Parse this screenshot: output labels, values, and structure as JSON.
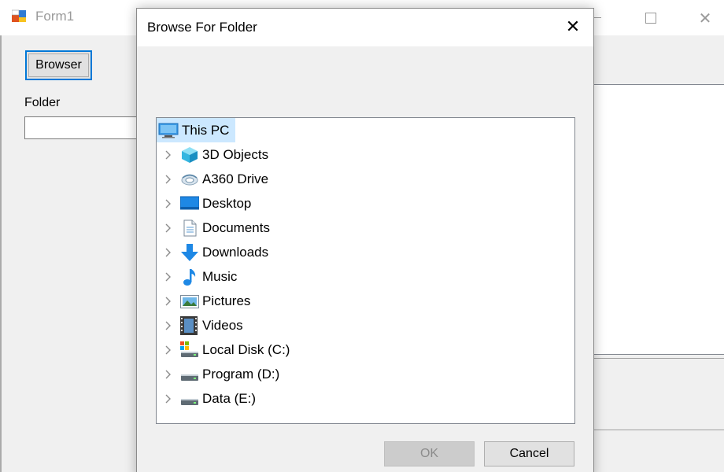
{
  "form1": {
    "title": "Form1",
    "browser_button": "Browser",
    "folder_label": "Folder",
    "folder_value": ""
  },
  "dialog": {
    "title": "Browse For Folder",
    "ok_label": "OK",
    "cancel_label": "Cancel",
    "tree": {
      "root": {
        "label": "This PC",
        "icon": "this-pc-icon"
      },
      "items": [
        {
          "label": "3D Objects",
          "icon": "3d-objects-icon"
        },
        {
          "label": "A360 Drive",
          "icon": "a360-drive-icon"
        },
        {
          "label": "Desktop",
          "icon": "desktop-icon"
        },
        {
          "label": "Documents",
          "icon": "documents-icon"
        },
        {
          "label": "Downloads",
          "icon": "downloads-icon"
        },
        {
          "label": "Music",
          "icon": "music-icon"
        },
        {
          "label": "Pictures",
          "icon": "pictures-icon"
        },
        {
          "label": "Videos",
          "icon": "videos-icon"
        },
        {
          "label": "Local Disk (C:)",
          "icon": "local-disk-icon"
        },
        {
          "label": "Program (D:)",
          "icon": "drive-icon"
        },
        {
          "label": "Data (E:)",
          "icon": "drive-icon"
        }
      ]
    }
  },
  "colors": {
    "selection": "#cce8ff",
    "focus_border": "#0078d7",
    "window_bg": "#f0f0f0"
  }
}
